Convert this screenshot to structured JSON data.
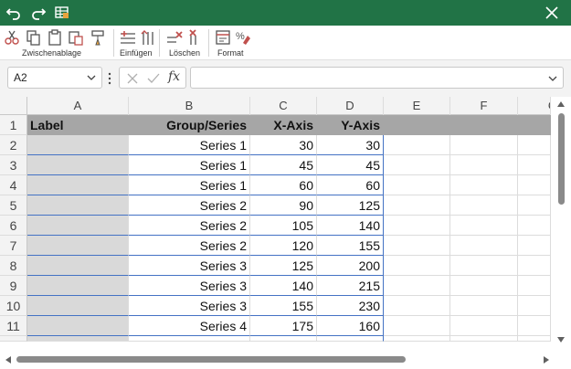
{
  "ribbon": {
    "groups": [
      {
        "label": "Zwischenablage"
      },
      {
        "label": "Einfügen"
      },
      {
        "label": "Löschen"
      },
      {
        "label": "Format"
      }
    ]
  },
  "formula_bar": {
    "name_box": "A2",
    "fx_label": "fx",
    "formula": ""
  },
  "columns": [
    "A",
    "B",
    "C",
    "D",
    "E",
    "F",
    "G"
  ],
  "rows": [
    "1",
    "2",
    "3",
    "4",
    "5",
    "6",
    "7",
    "8",
    "9",
    "10",
    "11"
  ],
  "header": [
    "Label",
    "Group/Series",
    "X-Axis",
    "Y-Axis"
  ],
  "data": [
    [
      "",
      "Series 1",
      "30",
      "30"
    ],
    [
      "",
      "Series 1",
      "45",
      "45"
    ],
    [
      "",
      "Series 1",
      "60",
      "60"
    ],
    [
      "",
      "Series 2",
      "90",
      "125"
    ],
    [
      "",
      "Series 2",
      "105",
      "140"
    ],
    [
      "",
      "Series 2",
      "120",
      "155"
    ],
    [
      "",
      "Series 3",
      "125",
      "200"
    ],
    [
      "",
      "Series 3",
      "140",
      "215"
    ],
    [
      "",
      "Series 3",
      "155",
      "230"
    ],
    [
      "",
      "Series 4",
      "175",
      "160"
    ]
  ],
  "colors": {
    "titlebar": "#217346",
    "header_fill": "#a6a6a6",
    "label_fill": "#d9d9d9",
    "table_border": "#4472c4"
  }
}
